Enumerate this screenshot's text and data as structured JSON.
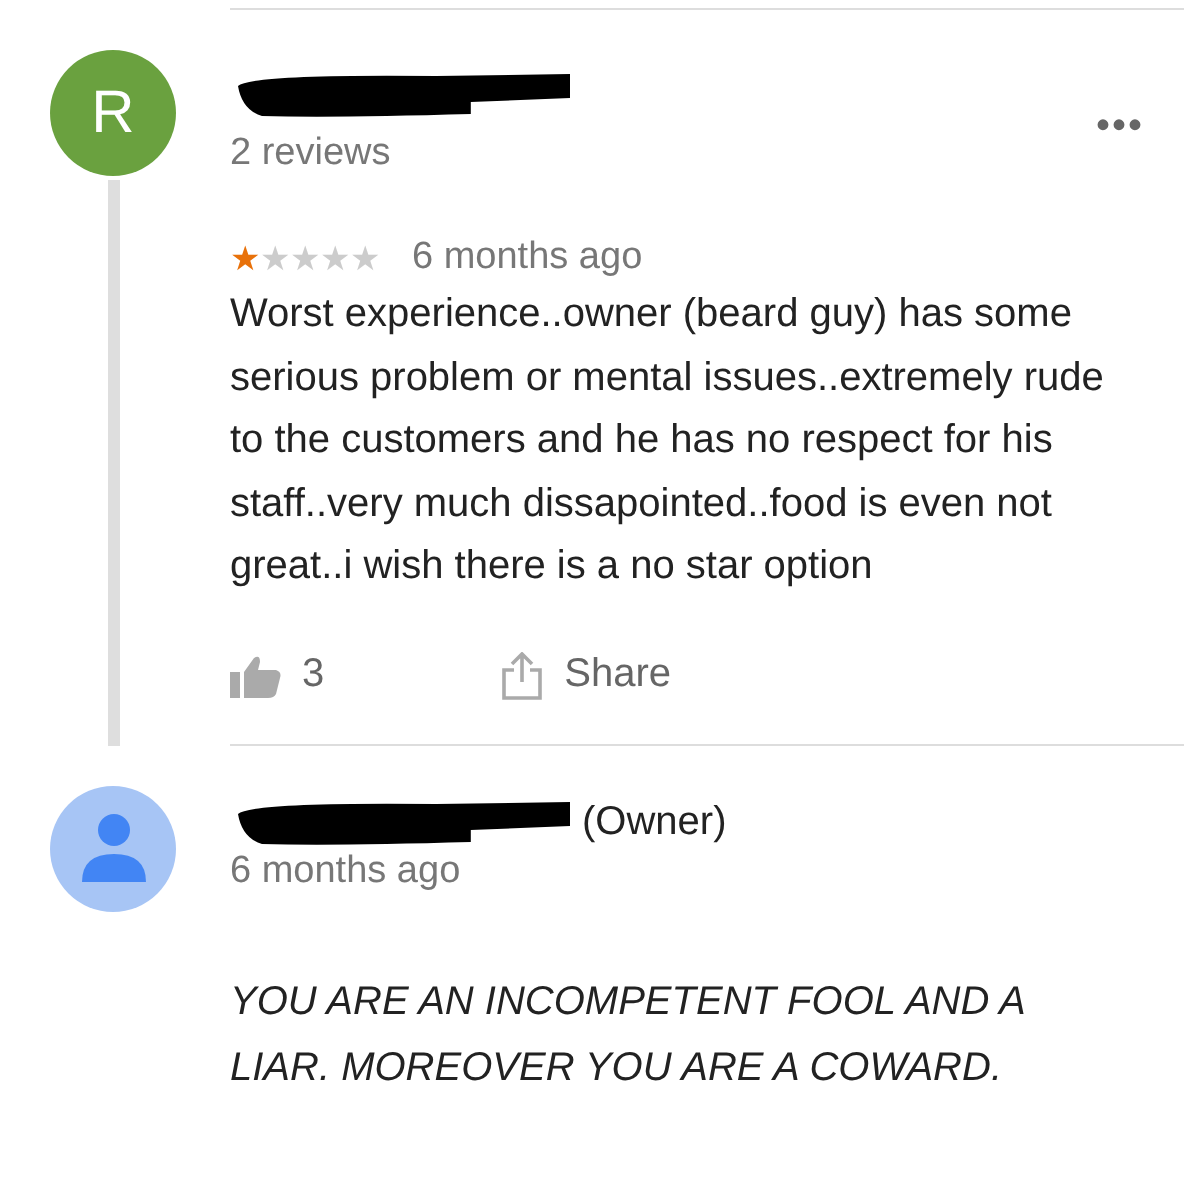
{
  "review": {
    "avatar_letter": "R",
    "review_count": "2 reviews",
    "more": "•••",
    "stars": 1,
    "time": "6 months ago",
    "text": "Worst experience..owner (beard guy) has some serious problem or mental issues..extremely rude to the customers and he has no respect for his staff..very much dissapointed..food is even not great..i wish there is a no star option",
    "likes": "3",
    "share": "Share"
  },
  "reply": {
    "name_suffix": "(Owner)",
    "time": "6 months ago",
    "text": "YOU ARE AN INCOMPETENT FOOL AND A LIAR. MOREOVER YOU ARE A COWARD."
  }
}
